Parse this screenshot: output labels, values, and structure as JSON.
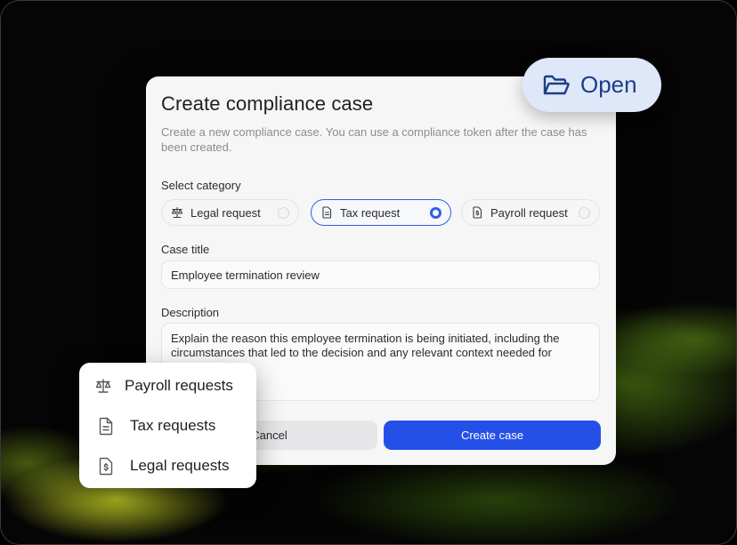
{
  "badge": {
    "label": "Open",
    "icon": "folder-open-icon"
  },
  "dialog": {
    "title": "Create compliance case",
    "subtitle": "Create a new compliance case. You can use a compliance token after the case has been created.",
    "category_label": "Select category",
    "categories": [
      {
        "label": "Legal request",
        "icon": "scale-icon",
        "selected": false
      },
      {
        "label": "Tax request",
        "icon": "document-icon",
        "selected": true
      },
      {
        "label": "Payroll request",
        "icon": "dollar-document-icon",
        "selected": false
      }
    ],
    "case_title_label": "Case title",
    "case_title_value": "Employee termination review",
    "description_label": "Description",
    "description_value": "Explain the reason this employee termination is being initiated, including the circumstances that led to the decision and any relevant context needed for",
    "cancel_label": "Cancel",
    "create_label": "Create case"
  },
  "dropdown": {
    "items": [
      {
        "label": "Payroll requests",
        "icon": "scale-icon"
      },
      {
        "label": "Tax requests",
        "icon": "document-icon"
      },
      {
        "label": "Legal requests",
        "icon": "dollar-document-icon"
      }
    ]
  },
  "colors": {
    "accent": "#2550e8",
    "badge_bg": "#dfe8f8",
    "badge_text": "#1c3f86"
  }
}
